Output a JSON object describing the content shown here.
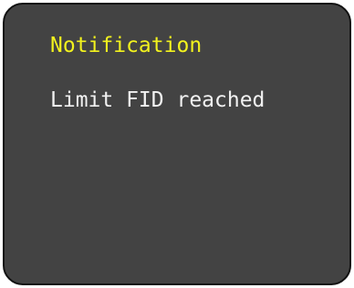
{
  "notification": {
    "title": "Notification",
    "message": "Limit FID reached"
  },
  "colors": {
    "panel_background": "#434343",
    "panel_border": "#121212",
    "title_text": "#f2f21e",
    "message_text": "#f2f2f2"
  }
}
